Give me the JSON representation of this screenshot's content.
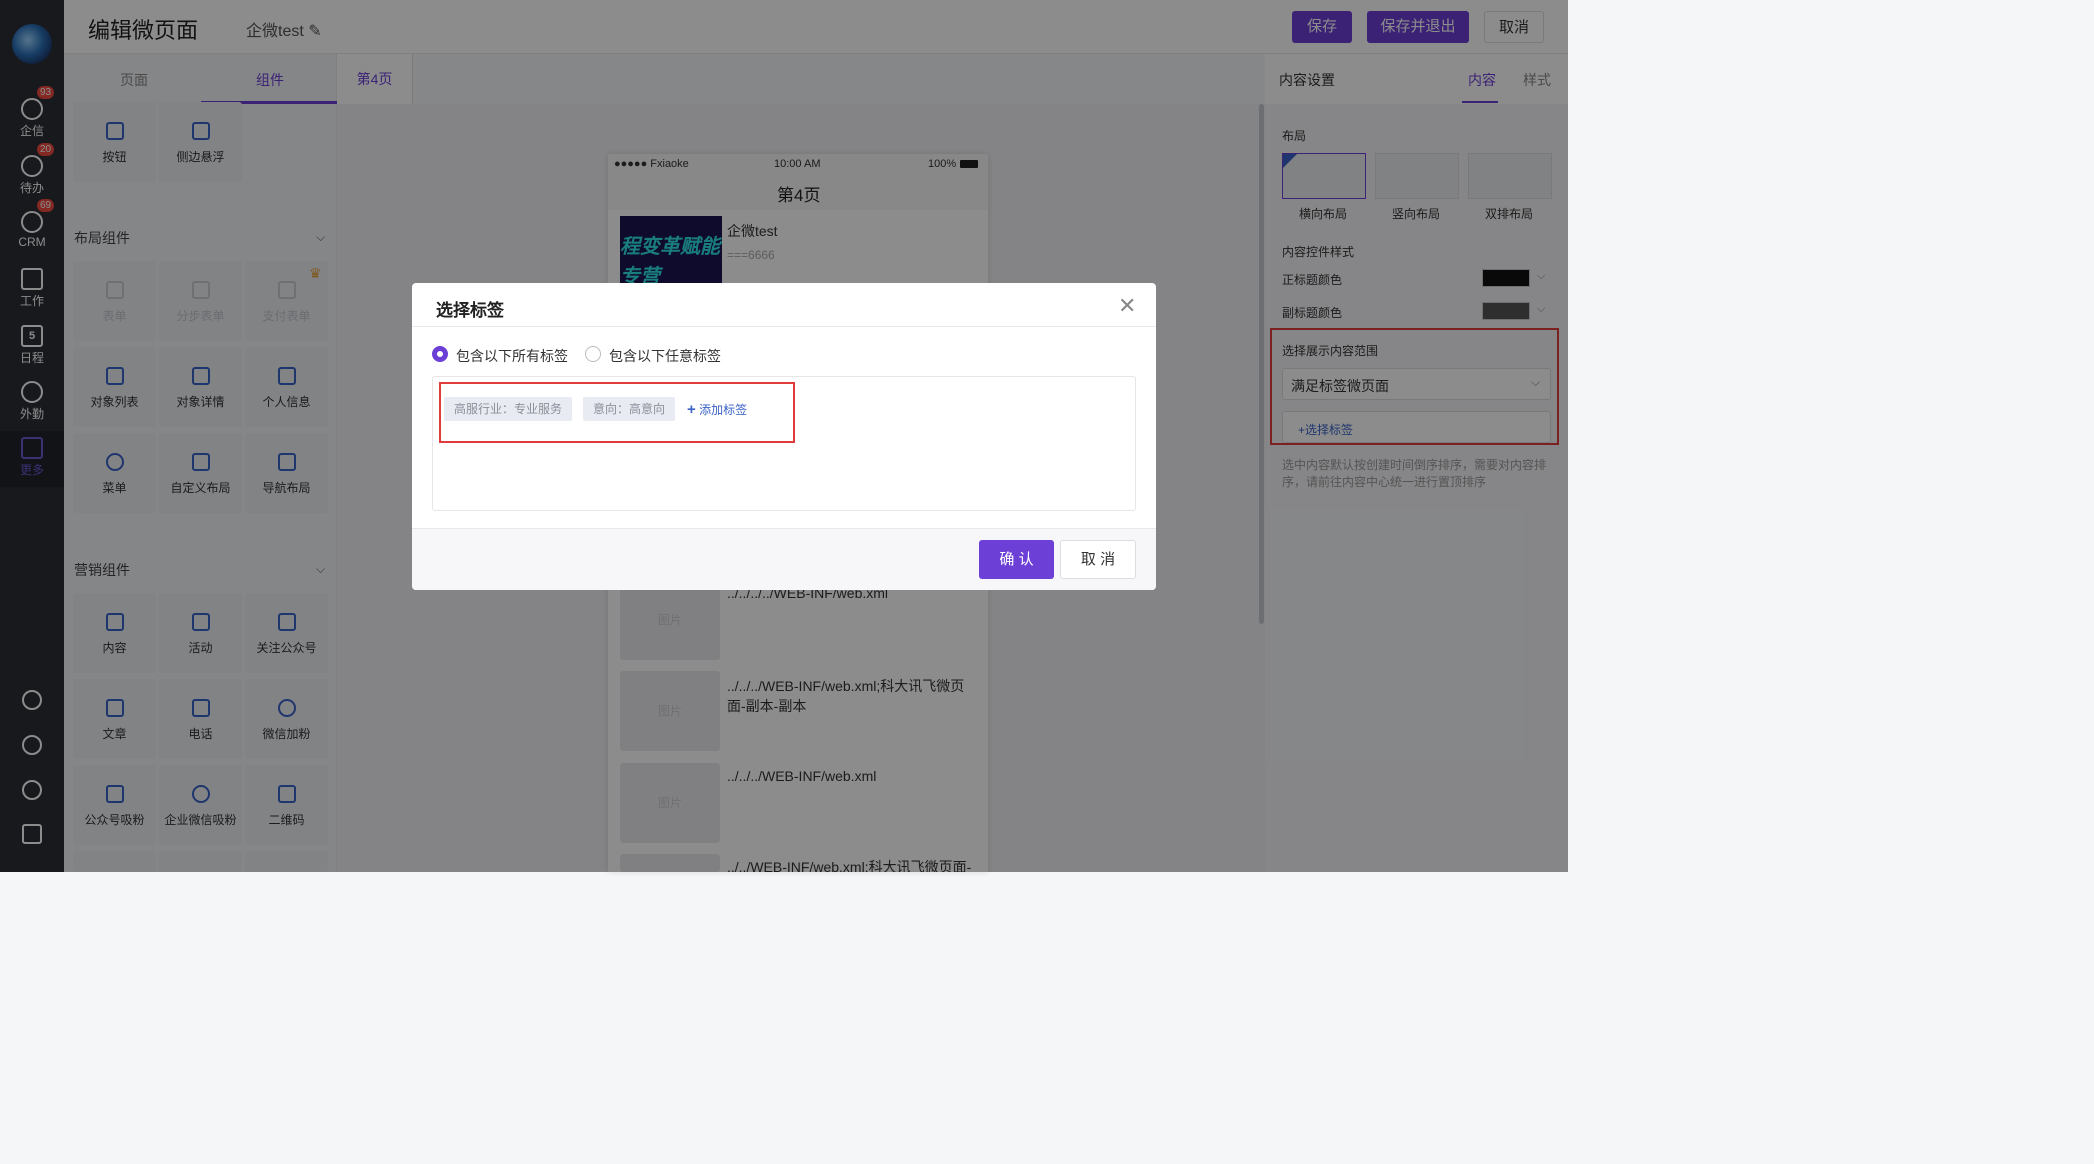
{
  "nav": {
    "items": [
      {
        "label": "企信",
        "icon": "chat-icon",
        "badge": "93"
      },
      {
        "label": "待办",
        "icon": "check-circle-icon",
        "badge": "20"
      },
      {
        "label": "CRM",
        "icon": "pie-chart-icon",
        "badge": "69"
      },
      {
        "label": "工作",
        "icon": "briefcase-icon",
        "badge": ""
      },
      {
        "label": "日程",
        "icon": "calendar-icon",
        "badge": ""
      },
      {
        "label": "外勤",
        "icon": "location-icon",
        "badge": ""
      },
      {
        "label": "更多",
        "icon": "grid-icon",
        "badge": ""
      }
    ],
    "calendar_day": "5"
  },
  "header": {
    "title": "编辑微页面",
    "subtitle": "企微test",
    "save": "保存",
    "save_exit": "保存并退出",
    "cancel": "取消"
  },
  "left_panel": {
    "tabs": [
      "页面",
      "组件"
    ],
    "top_cards": [
      "按钮",
      "侧边悬浮"
    ],
    "layout_section": "布局组件",
    "layout_cards": [
      "表单",
      "分步表单",
      "支付表单",
      "对象列表",
      "对象详情",
      "个人信息",
      "菜单",
      "自定义布局",
      "导航布局"
    ],
    "marketing_section": "营销组件",
    "marketing_cards": [
      "内容",
      "活动",
      "关注公众号",
      "文章",
      "电话",
      "微信加粉",
      "公众号吸粉",
      "企业微信吸粉",
      "二维码"
    ]
  },
  "page_tab": "第4页",
  "phone": {
    "carrier": "●●●●● Fxiaoke",
    "time": "10:00 AM",
    "battery": "100%",
    "title": "第4页",
    "banner_text_1": "程变革赋能",
    "banner_text_2": "专营",
    "item1_title": "企微test",
    "item1_sub": "===6666",
    "list": [
      {
        "thumb": "图片",
        "text": "../../../../WEB-INF/web.xml"
      },
      {
        "thumb": "图片",
        "text": "../../../WEB-INF/web.xml;科大讯飞微页面-副本-副本"
      },
      {
        "thumb": "图片",
        "text": "../../../WEB-INF/web.xml"
      },
      {
        "thumb": "",
        "text": "../../WEB-INF/web.xml;科大讯飞微页面-"
      }
    ]
  },
  "right_panel": {
    "title": "内容设置",
    "tab_content": "内容",
    "tab_style": "样式",
    "layout_label": "布局",
    "layouts": [
      "横向布局",
      "竖向布局",
      "双排布局"
    ],
    "style_label": "内容控件样式",
    "title_color_label": "正标题颜色",
    "subtitle_color_label": "副标题颜色",
    "title_color": "#111111",
    "subtitle_color": "#555555",
    "range_label": "选择展示内容范围",
    "range_value": "满足标签微页面",
    "select_tag": "+选择标签",
    "note": "选中内容默认按创建时间倒序排序，需要对内容排序，请前往内容中心统一进行置顶排序"
  },
  "modal": {
    "title": "选择标签",
    "option_all": "包含以下所有标签",
    "option_any": "包含以下任意标签",
    "tags": [
      "高服行业：专业服务",
      "意向：高意向"
    ],
    "add_tag": "添加标签",
    "confirm": "确 认",
    "cancel": "取 消"
  },
  "colors": {
    "accent": "#6c3fd6",
    "highlight": "#e03c3c",
    "nav_bg": "#2a2e36"
  }
}
